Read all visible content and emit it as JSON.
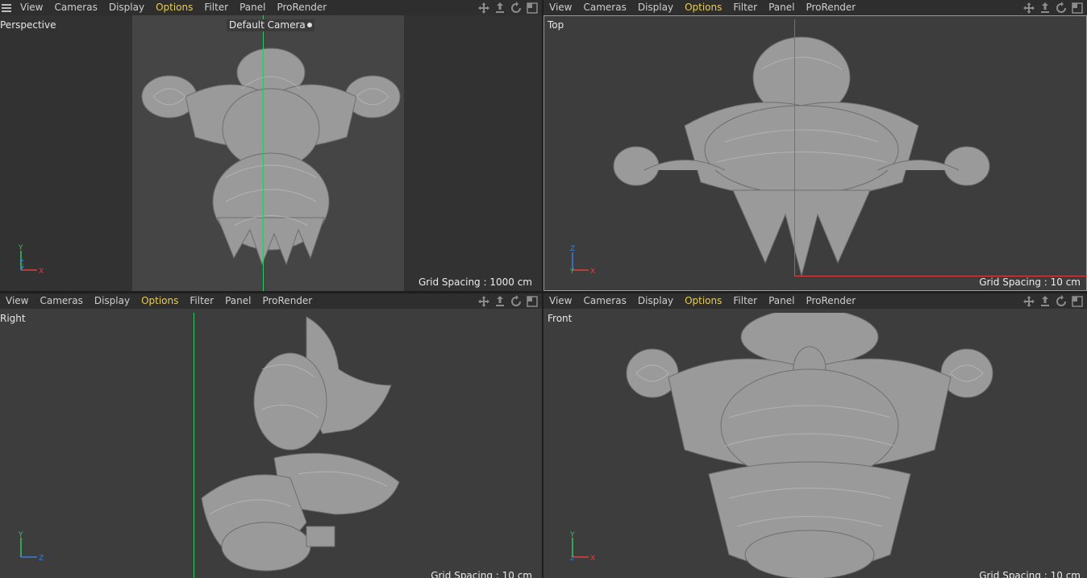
{
  "menu": {
    "items": [
      "View",
      "Cameras",
      "Display",
      "Options",
      "Filter",
      "Panel",
      "ProRender"
    ],
    "active": "Options",
    "hamburger_icon": "menu-icon"
  },
  "nav_icons": [
    "move-icon",
    "dolly-icon",
    "rotate-icon",
    "maximize-icon"
  ],
  "viewports": {
    "perspective": {
      "label": "Perspective",
      "camera": "Default Camera",
      "grid_spacing": "Grid Spacing : 1000 cm",
      "axes": [
        "Y",
        "Z",
        "X"
      ]
    },
    "top": {
      "label": "Top",
      "grid_spacing": "Grid Spacing : 10 cm",
      "axes": [
        "Z",
        "Y",
        "X"
      ]
    },
    "right": {
      "label": "Right",
      "grid_spacing": "Grid Spacing : 10 cm",
      "axes": [
        "Y",
        "Z"
      ]
    },
    "front": {
      "label": "Front",
      "grid_spacing": "Grid Spacing : 10 cm",
      "axes": [
        "Y",
        "Z",
        "X"
      ]
    }
  },
  "colors": {
    "active_menu": "#e6cc59",
    "axis_x": "#e04040",
    "axis_y": "#2ec860",
    "axis_z": "#3a7de0",
    "model": "#9a9a9a"
  }
}
